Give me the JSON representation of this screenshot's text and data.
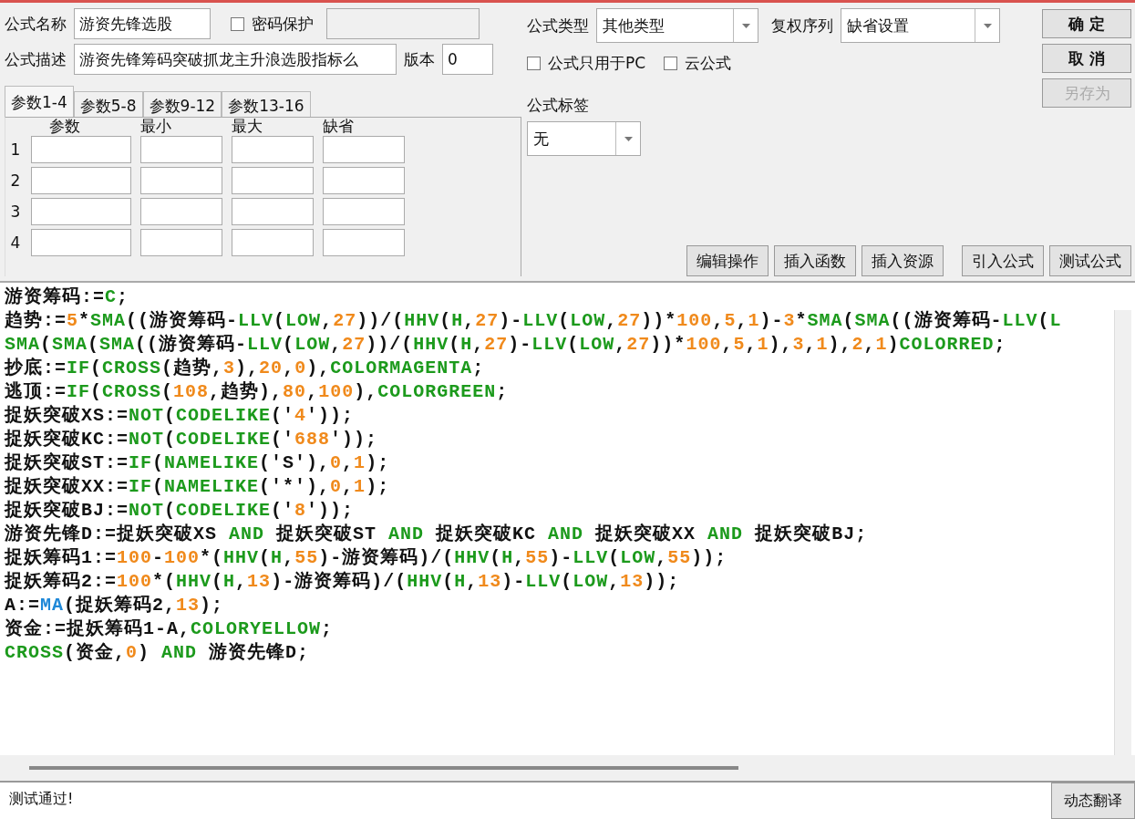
{
  "form": {
    "name_label": "公式名称",
    "name_value": "游资先锋选股",
    "password": {
      "label": "密码保护",
      "checked": false
    },
    "desc_label": "公式描述",
    "desc_value": "游资先锋筹码突破抓龙主升浪选股指标么",
    "version_label": "版本",
    "version_value": "0"
  },
  "tabs": [
    {
      "label": "参数1-4",
      "selected": true
    },
    {
      "label": "参数5-8",
      "selected": false
    },
    {
      "label": "参数9-12",
      "selected": false
    },
    {
      "label": "参数13-16",
      "selected": false
    }
  ],
  "params": {
    "columns": [
      "参数",
      "最小",
      "最大",
      "缺省"
    ],
    "rows": [
      "1",
      "2",
      "3",
      "4"
    ]
  },
  "type": {
    "label": "公式类型",
    "value": "其他类型"
  },
  "adjust": {
    "label": "复权序列",
    "value": "缺省设置"
  },
  "options": [
    {
      "label": "公式只用于PC",
      "checked": false
    },
    {
      "label": "云公式",
      "checked": false
    }
  ],
  "tag": {
    "label": "公式标签",
    "value": "无"
  },
  "side_buttons": [
    {
      "label": "确 定",
      "disabled": false
    },
    {
      "label": "取 消",
      "disabled": false
    },
    {
      "label": "另存为",
      "disabled": true
    }
  ],
  "tool_buttons": [
    "编辑操作",
    "插入函数",
    "插入资源",
    "引入公式",
    "测试公式"
  ],
  "code": [
    {
      "segments": [
        {
          "kind": "plain",
          "text": "游资筹码:="
        },
        {
          "kind": "fn",
          "text": "C"
        },
        {
          "kind": "plain",
          "text": ";"
        }
      ]
    },
    {
      "segments": [
        {
          "kind": "plain",
          "text": "趋势:="
        },
        {
          "kind": "num",
          "text": "5"
        },
        {
          "kind": "plain",
          "text": "*"
        },
        {
          "kind": "fn",
          "text": "SMA"
        },
        {
          "kind": "plain",
          "text": "((游资筹码-"
        },
        {
          "kind": "fn",
          "text": "LLV"
        },
        {
          "kind": "plain",
          "text": "("
        },
        {
          "kind": "fn",
          "text": "LOW"
        },
        {
          "kind": "plain",
          "text": ","
        },
        {
          "kind": "num",
          "text": "27"
        },
        {
          "kind": "plain",
          "text": "))/("
        },
        {
          "kind": "fn",
          "text": "HHV"
        },
        {
          "kind": "plain",
          "text": "("
        },
        {
          "kind": "fn",
          "text": "H"
        },
        {
          "kind": "plain",
          "text": ","
        },
        {
          "kind": "num",
          "text": "27"
        },
        {
          "kind": "plain",
          "text": ")-"
        },
        {
          "kind": "fn",
          "text": "LLV"
        },
        {
          "kind": "plain",
          "text": "("
        },
        {
          "kind": "fn",
          "text": "LOW"
        },
        {
          "kind": "plain",
          "text": ","
        },
        {
          "kind": "num",
          "text": "27"
        },
        {
          "kind": "plain",
          "text": "))*"
        },
        {
          "kind": "num",
          "text": "100"
        },
        {
          "kind": "plain",
          "text": ","
        },
        {
          "kind": "num",
          "text": "5"
        },
        {
          "kind": "plain",
          "text": ","
        },
        {
          "kind": "num",
          "text": "1"
        },
        {
          "kind": "plain",
          "text": ")-"
        },
        {
          "kind": "num",
          "text": "3"
        },
        {
          "kind": "plain",
          "text": "*"
        },
        {
          "kind": "fn",
          "text": "SMA"
        },
        {
          "kind": "plain",
          "text": "("
        },
        {
          "kind": "fn",
          "text": "SMA"
        },
        {
          "kind": "plain",
          "text": "((游资筹码-"
        },
        {
          "kind": "fn",
          "text": "LLV"
        },
        {
          "kind": "plain",
          "text": "("
        },
        {
          "kind": "fn",
          "text": "L"
        }
      ]
    },
    {
      "segments": [
        {
          "kind": "fn",
          "text": "SMA"
        },
        {
          "kind": "plain",
          "text": "("
        },
        {
          "kind": "fn",
          "text": "SMA"
        },
        {
          "kind": "plain",
          "text": "("
        },
        {
          "kind": "fn",
          "text": "SMA"
        },
        {
          "kind": "plain",
          "text": "((游资筹码-"
        },
        {
          "kind": "fn",
          "text": "LLV"
        },
        {
          "kind": "plain",
          "text": "("
        },
        {
          "kind": "fn",
          "text": "LOW"
        },
        {
          "kind": "plain",
          "text": ","
        },
        {
          "kind": "num",
          "text": "27"
        },
        {
          "kind": "plain",
          "text": "))/("
        },
        {
          "kind": "fn",
          "text": "HHV"
        },
        {
          "kind": "plain",
          "text": "("
        },
        {
          "kind": "fn",
          "text": "H"
        },
        {
          "kind": "plain",
          "text": ","
        },
        {
          "kind": "num",
          "text": "27"
        },
        {
          "kind": "plain",
          "text": ")-"
        },
        {
          "kind": "fn",
          "text": "LLV"
        },
        {
          "kind": "plain",
          "text": "("
        },
        {
          "kind": "fn",
          "text": "LOW"
        },
        {
          "kind": "plain",
          "text": ","
        },
        {
          "kind": "num",
          "text": "27"
        },
        {
          "kind": "plain",
          "text": "))*"
        },
        {
          "kind": "num",
          "text": "100"
        },
        {
          "kind": "plain",
          "text": ","
        },
        {
          "kind": "num",
          "text": "5"
        },
        {
          "kind": "plain",
          "text": ","
        },
        {
          "kind": "num",
          "text": "1"
        },
        {
          "kind": "plain",
          "text": "),"
        },
        {
          "kind": "num",
          "text": "3"
        },
        {
          "kind": "plain",
          "text": ","
        },
        {
          "kind": "num",
          "text": "1"
        },
        {
          "kind": "plain",
          "text": "),"
        },
        {
          "kind": "num",
          "text": "2"
        },
        {
          "kind": "plain",
          "text": ","
        },
        {
          "kind": "num",
          "text": "1"
        },
        {
          "kind": "plain",
          "text": ")"
        },
        {
          "kind": "fn",
          "text": "COLORRED"
        },
        {
          "kind": "plain",
          "text": ";"
        }
      ]
    },
    {
      "segments": [
        {
          "kind": "plain",
          "text": "抄底:="
        },
        {
          "kind": "fn",
          "text": "IF"
        },
        {
          "kind": "plain",
          "text": "("
        },
        {
          "kind": "fn",
          "text": "CROSS"
        },
        {
          "kind": "plain",
          "text": "(趋势,"
        },
        {
          "kind": "num",
          "text": "3"
        },
        {
          "kind": "plain",
          "text": "),"
        },
        {
          "kind": "num",
          "text": "20"
        },
        {
          "kind": "plain",
          "text": ","
        },
        {
          "kind": "num",
          "text": "0"
        },
        {
          "kind": "plain",
          "text": "),"
        },
        {
          "kind": "fn",
          "text": "COLORMAGENTA"
        },
        {
          "kind": "plain",
          "text": ";"
        }
      ]
    },
    {
      "segments": [
        {
          "kind": "plain",
          "text": "逃顶:="
        },
        {
          "kind": "fn",
          "text": "IF"
        },
        {
          "kind": "plain",
          "text": "("
        },
        {
          "kind": "fn",
          "text": "CROSS"
        },
        {
          "kind": "plain",
          "text": "("
        },
        {
          "kind": "num",
          "text": "108"
        },
        {
          "kind": "plain",
          "text": ",趋势),"
        },
        {
          "kind": "num",
          "text": "80"
        },
        {
          "kind": "plain",
          "text": ","
        },
        {
          "kind": "num",
          "text": "100"
        },
        {
          "kind": "plain",
          "text": "),"
        },
        {
          "kind": "fn",
          "text": "COLORGREEN"
        },
        {
          "kind": "plain",
          "text": ";"
        }
      ]
    },
    {
      "segments": [
        {
          "kind": "plain",
          "text": "捉妖突破XS:="
        },
        {
          "kind": "fn",
          "text": "NOT"
        },
        {
          "kind": "plain",
          "text": "("
        },
        {
          "kind": "fn",
          "text": "CODELIKE"
        },
        {
          "kind": "plain",
          "text": "('"
        },
        {
          "kind": "num",
          "text": "4"
        },
        {
          "kind": "plain",
          "text": "'));"
        }
      ]
    },
    {
      "segments": [
        {
          "kind": "plain",
          "text": "捉妖突破KC:="
        },
        {
          "kind": "fn",
          "text": "NOT"
        },
        {
          "kind": "plain",
          "text": "("
        },
        {
          "kind": "fn",
          "text": "CODELIKE"
        },
        {
          "kind": "plain",
          "text": "('"
        },
        {
          "kind": "num",
          "text": "688"
        },
        {
          "kind": "plain",
          "text": "'));"
        }
      ]
    },
    {
      "segments": [
        {
          "kind": "plain",
          "text": "捉妖突破ST:="
        },
        {
          "kind": "fn",
          "text": "IF"
        },
        {
          "kind": "plain",
          "text": "("
        },
        {
          "kind": "fn",
          "text": "NAMELIKE"
        },
        {
          "kind": "plain",
          "text": "('S'),"
        },
        {
          "kind": "num",
          "text": "0"
        },
        {
          "kind": "plain",
          "text": ","
        },
        {
          "kind": "num",
          "text": "1"
        },
        {
          "kind": "plain",
          "text": ");"
        }
      ]
    },
    {
      "segments": [
        {
          "kind": "plain",
          "text": "捉妖突破XX:="
        },
        {
          "kind": "fn",
          "text": "IF"
        },
        {
          "kind": "plain",
          "text": "("
        },
        {
          "kind": "fn",
          "text": "NAMELIKE"
        },
        {
          "kind": "plain",
          "text": "('*'),"
        },
        {
          "kind": "num",
          "text": "0"
        },
        {
          "kind": "plain",
          "text": ","
        },
        {
          "kind": "num",
          "text": "1"
        },
        {
          "kind": "plain",
          "text": ");"
        }
      ]
    },
    {
      "segments": [
        {
          "kind": "plain",
          "text": "捉妖突破BJ:="
        },
        {
          "kind": "fn",
          "text": "NOT"
        },
        {
          "kind": "plain",
          "text": "("
        },
        {
          "kind": "fn",
          "text": "CODELIKE"
        },
        {
          "kind": "plain",
          "text": "('"
        },
        {
          "kind": "num",
          "text": "8"
        },
        {
          "kind": "plain",
          "text": "'));"
        }
      ]
    },
    {
      "segments": [
        {
          "kind": "plain",
          "text": "游资先锋D:=捉妖突破XS "
        },
        {
          "kind": "fn",
          "text": "AND"
        },
        {
          "kind": "plain",
          "text": " 捉妖突破ST "
        },
        {
          "kind": "fn",
          "text": "AND"
        },
        {
          "kind": "plain",
          "text": " 捉妖突破KC "
        },
        {
          "kind": "fn",
          "text": "AND"
        },
        {
          "kind": "plain",
          "text": " 捉妖突破XX "
        },
        {
          "kind": "fn",
          "text": "AND"
        },
        {
          "kind": "plain",
          "text": " 捉妖突破BJ;"
        }
      ]
    },
    {
      "segments": [
        {
          "kind": "plain",
          "text": "捉妖筹码1:="
        },
        {
          "kind": "num",
          "text": "100"
        },
        {
          "kind": "plain",
          "text": "-"
        },
        {
          "kind": "num",
          "text": "100"
        },
        {
          "kind": "plain",
          "text": "*("
        },
        {
          "kind": "fn",
          "text": "HHV"
        },
        {
          "kind": "plain",
          "text": "("
        },
        {
          "kind": "fn",
          "text": "H"
        },
        {
          "kind": "plain",
          "text": ","
        },
        {
          "kind": "num",
          "text": "55"
        },
        {
          "kind": "plain",
          "text": ")-游资筹码)/("
        },
        {
          "kind": "fn",
          "text": "HHV"
        },
        {
          "kind": "plain",
          "text": "("
        },
        {
          "kind": "fn",
          "text": "H"
        },
        {
          "kind": "plain",
          "text": ","
        },
        {
          "kind": "num",
          "text": "55"
        },
        {
          "kind": "plain",
          "text": ")-"
        },
        {
          "kind": "fn",
          "text": "LLV"
        },
        {
          "kind": "plain",
          "text": "("
        },
        {
          "kind": "fn",
          "text": "LOW"
        },
        {
          "kind": "plain",
          "text": ","
        },
        {
          "kind": "num",
          "text": "55"
        },
        {
          "kind": "plain",
          "text": "));"
        }
      ]
    },
    {
      "segments": [
        {
          "kind": "plain",
          "text": "捉妖筹码2:="
        },
        {
          "kind": "num",
          "text": "100"
        },
        {
          "kind": "plain",
          "text": "*("
        },
        {
          "kind": "fn",
          "text": "HHV"
        },
        {
          "kind": "plain",
          "text": "("
        },
        {
          "kind": "fn",
          "text": "H"
        },
        {
          "kind": "plain",
          "text": ","
        },
        {
          "kind": "num",
          "text": "13"
        },
        {
          "kind": "plain",
          "text": ")-游资筹码)/("
        },
        {
          "kind": "fn",
          "text": "HHV"
        },
        {
          "kind": "plain",
          "text": "("
        },
        {
          "kind": "fn",
          "text": "H"
        },
        {
          "kind": "plain",
          "text": ","
        },
        {
          "kind": "num",
          "text": "13"
        },
        {
          "kind": "plain",
          "text": ")-"
        },
        {
          "kind": "fn",
          "text": "LLV"
        },
        {
          "kind": "plain",
          "text": "("
        },
        {
          "kind": "fn",
          "text": "LOW"
        },
        {
          "kind": "plain",
          "text": ","
        },
        {
          "kind": "num",
          "text": "13"
        },
        {
          "kind": "plain",
          "text": "));"
        }
      ]
    },
    {
      "segments": [
        {
          "kind": "plain",
          "text": "A:="
        },
        {
          "kind": "builtin",
          "text": "MA"
        },
        {
          "kind": "plain",
          "text": "(捉妖筹码2,"
        },
        {
          "kind": "num",
          "text": "13"
        },
        {
          "kind": "plain",
          "text": ");"
        }
      ]
    },
    {
      "segments": [
        {
          "kind": "plain",
          "text": "资金:=捉妖筹码1-A,"
        },
        {
          "kind": "fn",
          "text": "COLORYELLOW"
        },
        {
          "kind": "plain",
          "text": ";"
        }
      ]
    },
    {
      "segments": [
        {
          "kind": "fn",
          "text": "CROSS"
        },
        {
          "kind": "plain",
          "text": "(资金,"
        },
        {
          "kind": "num",
          "text": "0"
        },
        {
          "kind": "plain",
          "text": ") "
        },
        {
          "kind": "fn",
          "text": "AND"
        },
        {
          "kind": "plain",
          "text": " 游资先锋D;"
        }
      ]
    }
  ],
  "status": {
    "message": "测试通过!",
    "button": "动态翻译"
  }
}
